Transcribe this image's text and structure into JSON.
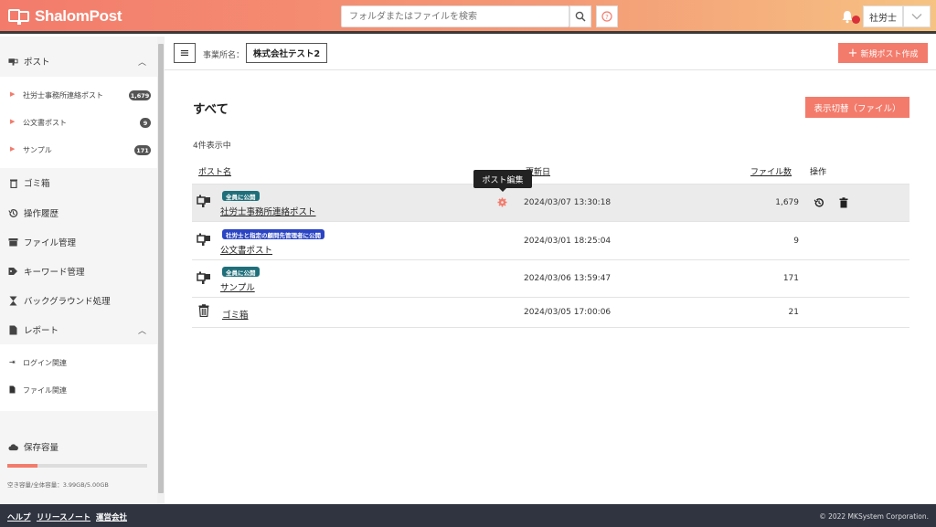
{
  "app": {
    "logo": "ShalomPost"
  },
  "header": {
    "search_placeholder": "フォルダまたはファイルを検索",
    "user_name": "社労士"
  },
  "sidebar": {
    "post_section": {
      "label": "ポスト",
      "items": [
        {
          "label": "社労士事務所連絡ポスト",
          "count": "1,679"
        },
        {
          "label": "公文書ポスト",
          "count": "9"
        },
        {
          "label": "サンプル",
          "count": "171"
        }
      ]
    },
    "nav": [
      {
        "label": "ゴミ箱"
      },
      {
        "label": "操作履歴"
      },
      {
        "label": "ファイル管理"
      },
      {
        "label": "キーワード管理"
      },
      {
        "label": "バックグラウンド処理"
      }
    ],
    "report_section": {
      "label": "レポート",
      "items": [
        {
          "label": "ログイン関連"
        },
        {
          "label": "ファイル関連"
        }
      ]
    },
    "storage": {
      "label": "保存容量",
      "used_fraction": 0.22,
      "text": "空き容量/全体容量：3.99GB/5.00GB"
    }
  },
  "main": {
    "office_label": "事業所名：",
    "office_name": "株式会社テスト2",
    "new_post_button": "新規ポスト作成",
    "title": "すべて",
    "switch_button": "表示切替（ファイル）",
    "count_text": "4件表示中",
    "columns": {
      "post_name": "ポスト名",
      "updated": "更新日",
      "files": "ファイル数",
      "actions": "操作"
    },
    "tooltip": "ポスト編集",
    "rows": [
      {
        "badge": "全員に公開",
        "name": "社労士事務所連絡ポスト",
        "date": "2024/03/07 13:30:18",
        "files": "1,679"
      },
      {
        "badge": "社労士と指定の顧問先管理者に公開",
        "name": "公文書ポスト",
        "date": "2024/03/01 18:25:04",
        "files": "9"
      },
      {
        "badge": "全員に公開",
        "name": "サンプル",
        "date": "2024/03/06 13:59:47",
        "files": "171"
      },
      {
        "badge": "",
        "name": "ゴミ箱",
        "date": "2024/03/05 17:00:06",
        "files": "21"
      }
    ]
  },
  "footer": {
    "links": [
      "ヘルプ",
      "リリースノート",
      "運営会社"
    ],
    "copyright": "© 2022 MKSystem Corporation."
  },
  "colors": {
    "accent": "#f37b6b",
    "footer": "#2f3440",
    "badge_teal": "#1f6f7a",
    "badge_blue": "#2a44c4"
  }
}
